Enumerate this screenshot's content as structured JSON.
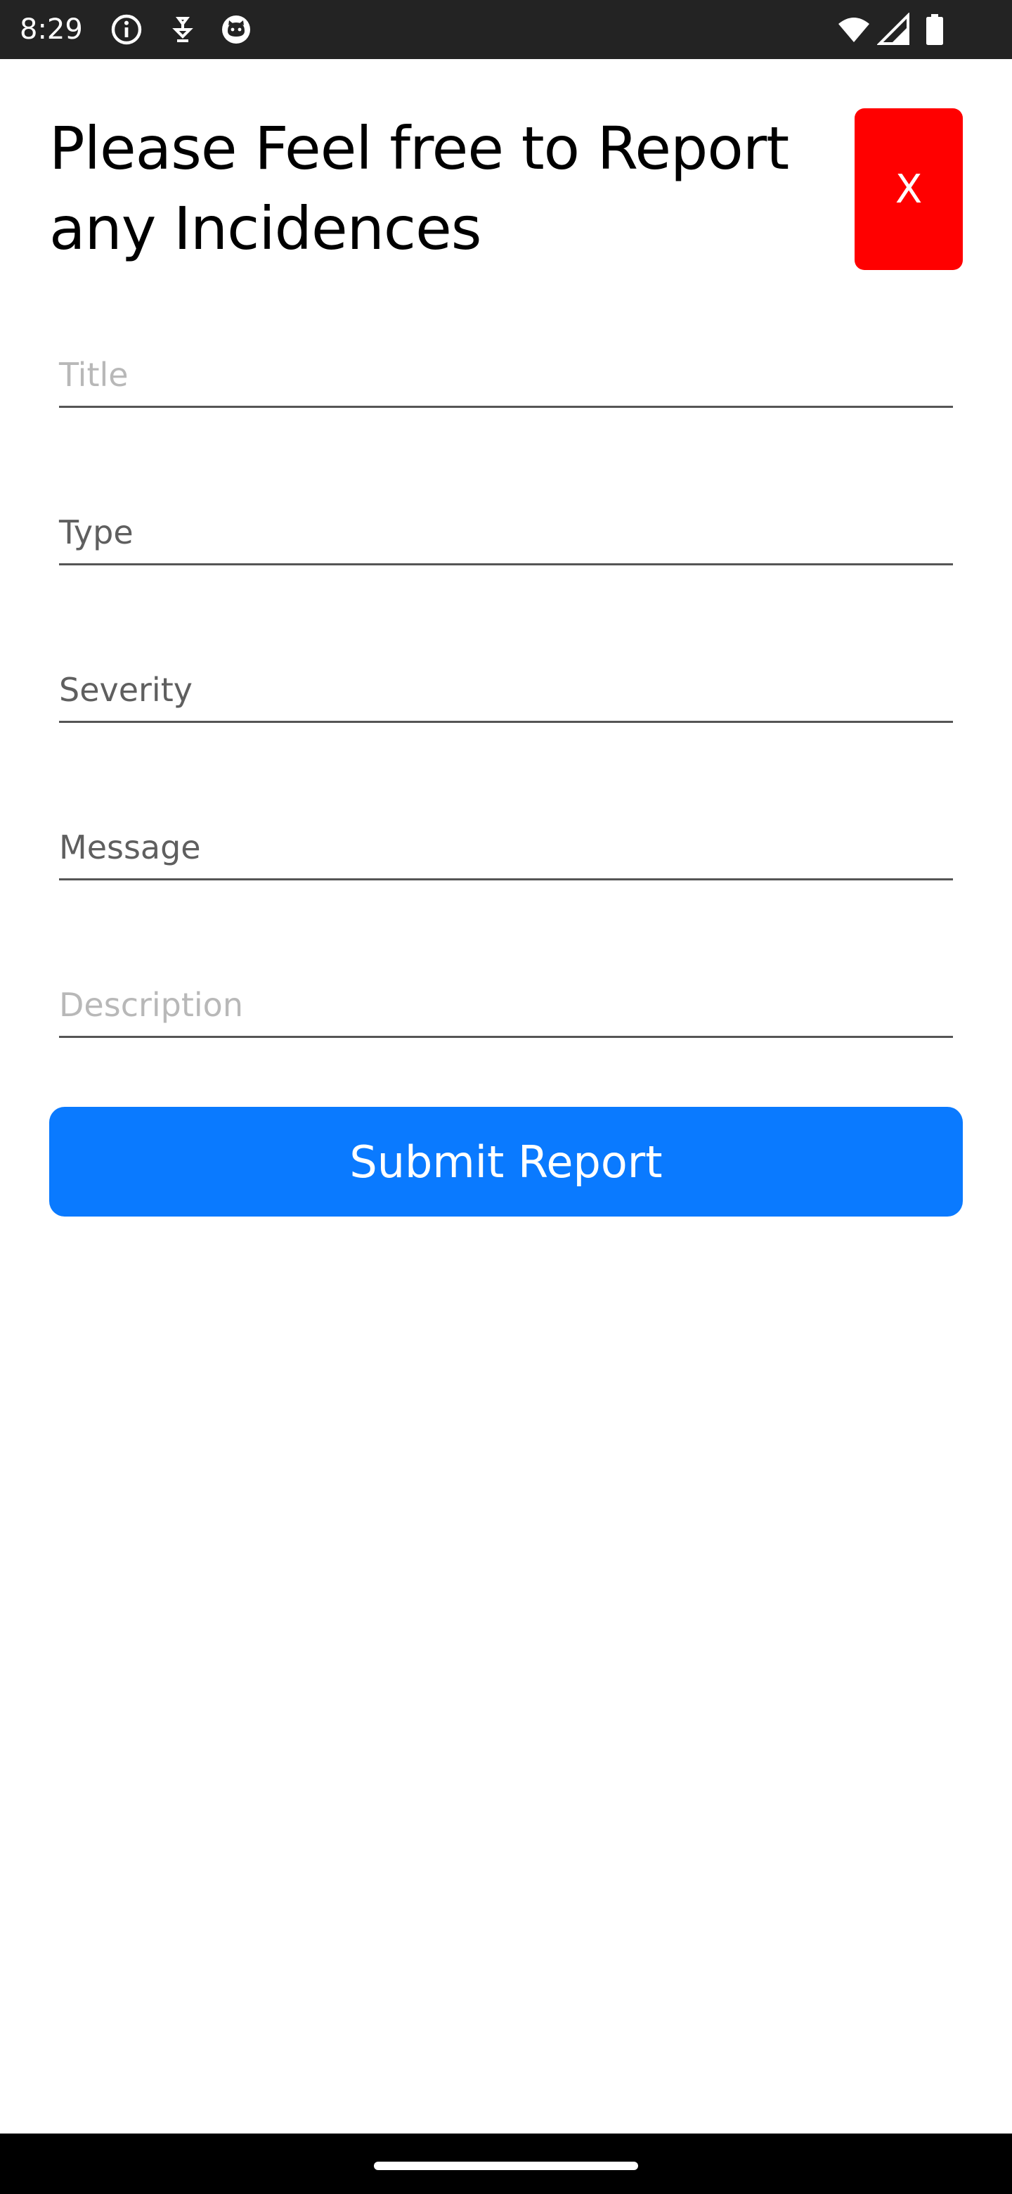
{
  "status_bar": {
    "time": "8:29",
    "icons": [
      "info-icon",
      "download-icon",
      "cat-icon",
      "wifi-icon",
      "signal-icon",
      "battery-icon"
    ]
  },
  "header": {
    "title": "Please Feel free to Report any Incidences",
    "close_label": "X"
  },
  "form": {
    "fields": [
      {
        "name": "title",
        "text": "Title",
        "state": "placeholder"
      },
      {
        "name": "type",
        "text": "Type",
        "state": "value"
      },
      {
        "name": "severity",
        "text": "Severity",
        "state": "value"
      },
      {
        "name": "message",
        "text": "Message",
        "state": "value"
      },
      {
        "name": "description",
        "text": "Description",
        "state": "placeholder"
      }
    ],
    "submit_label": "Submit Report"
  },
  "colors": {
    "close_button": "#ff0000",
    "submit_button": "#0a7aff",
    "status_bar": "#232323"
  }
}
